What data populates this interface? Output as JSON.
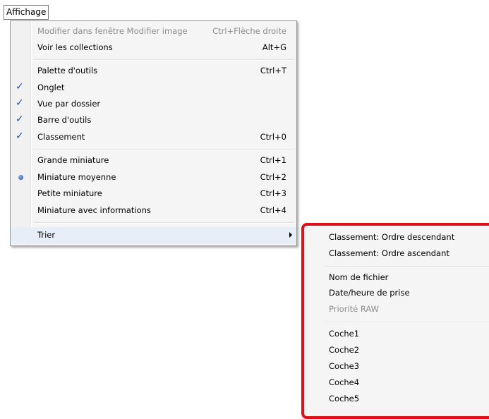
{
  "menubar": {
    "title": "Affichage"
  },
  "menu": {
    "items": [
      {
        "label": "Modifier dans fenêtre Modifier image",
        "shortcut": "Ctrl+Flèche droite"
      },
      {
        "label": "Voir les collections",
        "shortcut": "Alt+G"
      },
      {
        "label": "Palette d'outils",
        "shortcut": "Ctrl+T"
      },
      {
        "label": "Onglet",
        "shortcut": ""
      },
      {
        "label": "Vue par dossier",
        "shortcut": ""
      },
      {
        "label": "Barre d'outils",
        "shortcut": ""
      },
      {
        "label": "Classement",
        "shortcut": "Ctrl+0"
      },
      {
        "label": "Grande miniature",
        "shortcut": "Ctrl+1"
      },
      {
        "label": "Miniature moyenne",
        "shortcut": "Ctrl+2"
      },
      {
        "label": "Petite miniature",
        "shortcut": "Ctrl+3"
      },
      {
        "label": "Miniature avec informations",
        "shortcut": "Ctrl+4"
      },
      {
        "label": "Trier",
        "shortcut": ""
      }
    ],
    "check_glyph": "✓"
  },
  "submenu": {
    "items": [
      {
        "label": "Classement: Ordre descendant"
      },
      {
        "label": "Classement: Ordre ascendant"
      },
      {
        "label": "Nom de fichier"
      },
      {
        "label": "Date/heure de prise"
      },
      {
        "label": "Priorité RAW"
      },
      {
        "label": "Coche1"
      },
      {
        "label": "Coche2"
      },
      {
        "label": "Coche3"
      },
      {
        "label": "Coche4"
      },
      {
        "label": "Coche5"
      }
    ],
    "highlight_color": "#e0101a"
  }
}
